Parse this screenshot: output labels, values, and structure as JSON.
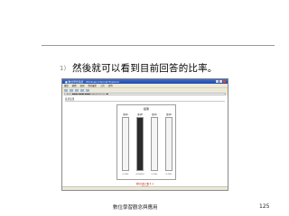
{
  "slide": {
    "bullet": "1)",
    "heading": "然後就可以看到目前回答的比率。",
    "footer": "數位學習觀念與應用",
    "page_number": "125"
  },
  "screenshot": {
    "window_title": "■ 數位學習系統 - Windows Internet Explorer",
    "menu": [
      "檔案",
      "編輯",
      "檢視",
      "我的最愛",
      "工具",
      "說明"
    ],
    "address": "http://■■■.■■■/■■■/results.php?id=■",
    "page_sub": "投票結果",
    "panel_title": "結果",
    "columns": [
      {
        "header": "選項A",
        "fraction": 0.0,
        "foot": "0 (0%)"
      },
      {
        "header": "選項B",
        "fraction": 1.0,
        "foot": "4 (100%)"
      },
      {
        "header": "選項C",
        "fraction": 0.0,
        "foot": "0 (0%)"
      },
      {
        "header": "選項D",
        "fraction": 0.0,
        "foot": "0 (0%)"
      }
    ],
    "summary": "總共回答人數 4 人",
    "back": "回上頁",
    "colors": {
      "titlebar": "#1d4aa8",
      "bar_fill": "#2b2b2b",
      "accent_red": "#c00000"
    }
  }
}
